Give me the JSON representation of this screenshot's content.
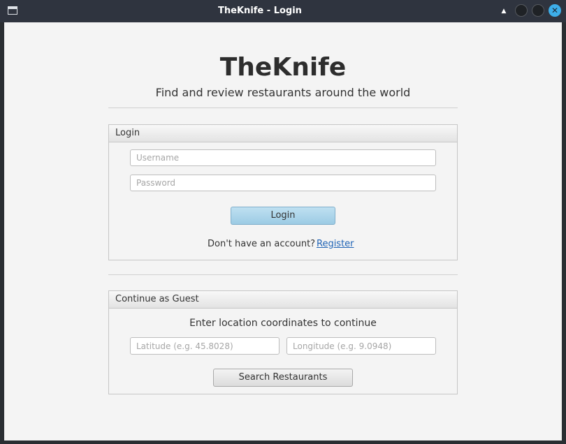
{
  "window": {
    "title": "TheKnife - Login",
    "controls": [
      "keep-above-icon",
      "minimize-icon",
      "maximize-icon",
      "close-icon"
    ],
    "close_glyph": "✕"
  },
  "header": {
    "app_title": "TheKnife",
    "subtitle": "Find and review restaurants around the world"
  },
  "login_panel": {
    "title": "Login",
    "username_placeholder": "Username",
    "password_placeholder": "Password",
    "login_button": "Login",
    "no_account_text": "Don't have an account?",
    "register_link": "Register"
  },
  "guest_panel": {
    "title": "Continue as Guest",
    "instruction": "Enter location coordinates to continue",
    "latitude_placeholder": "Latitude (e.g. 45.8028)",
    "longitude_placeholder": "Longitude (e.g. 9.0948)",
    "search_button": "Search Restaurants"
  },
  "colors": {
    "accent": "#3daee9",
    "login_button": "#a8d3ea",
    "link": "#1f63b5",
    "background": "#f4f4f4"
  }
}
